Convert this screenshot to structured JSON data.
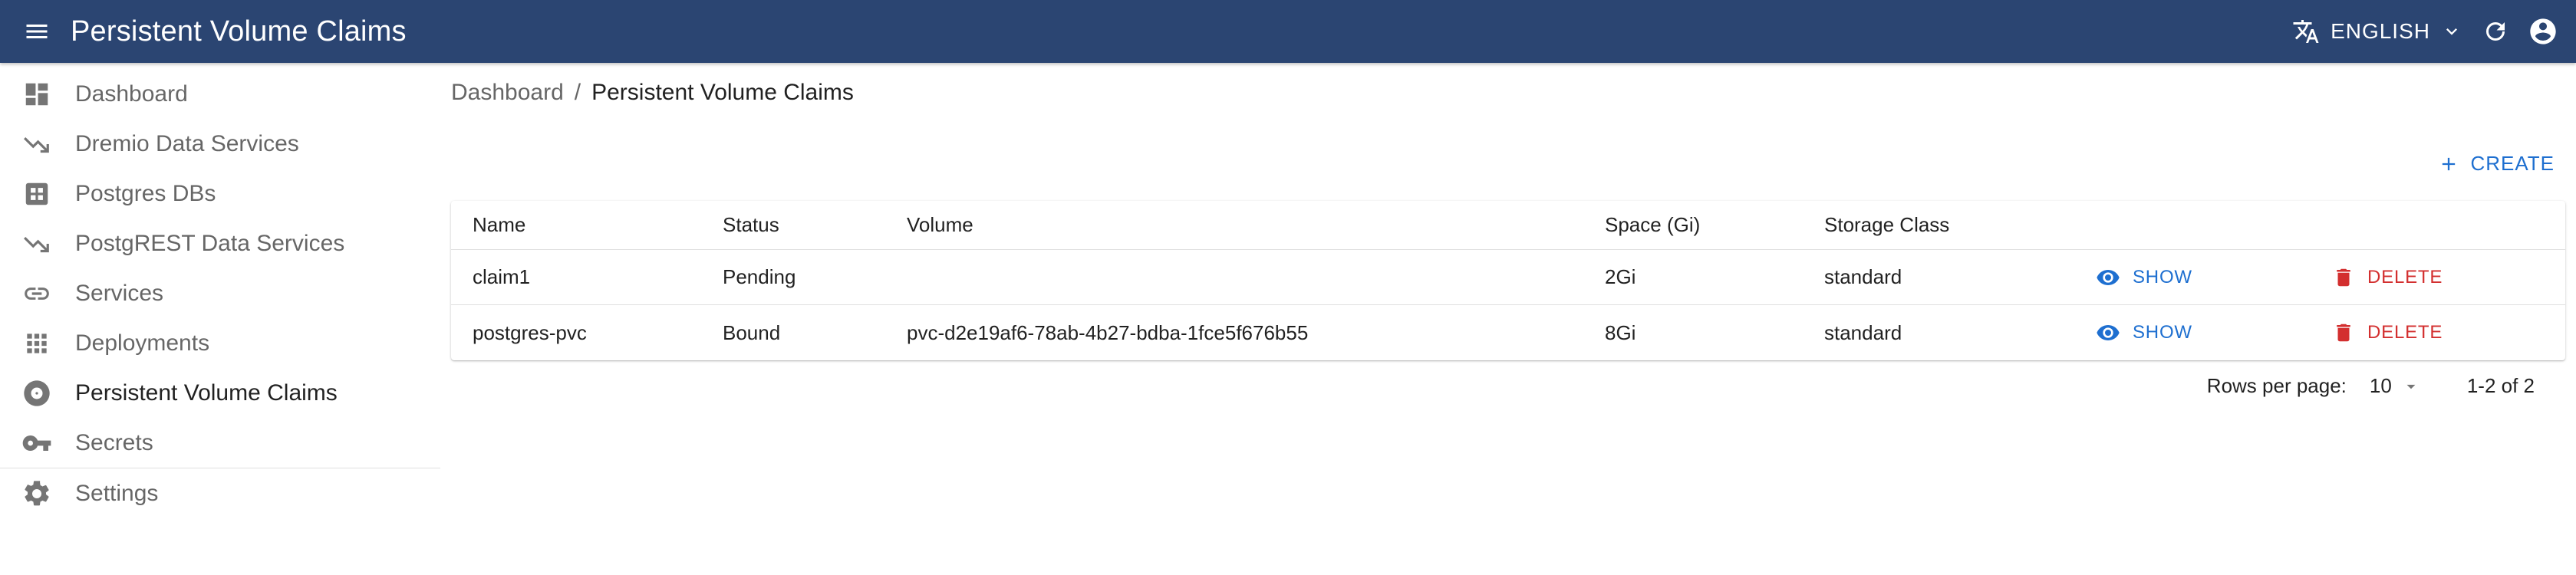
{
  "appbar": {
    "title": "Persistent Volume Claims",
    "language": "ENGLISH",
    "colors": {
      "background": "#2b4572",
      "text": "#ffffff"
    },
    "icons": [
      "menu-icon",
      "translate-icon",
      "chevron-down-icon",
      "refresh-icon",
      "account-circle-icon"
    ]
  },
  "sidebar": {
    "items": [
      {
        "label": "Dashboard",
        "icon": "dashboard-icon"
      },
      {
        "label": "Dremio Data Services",
        "icon": "trending-down-icon"
      },
      {
        "label": "Postgres DBs",
        "icon": "grid-box-icon"
      },
      {
        "label": "PostgREST Data Services",
        "icon": "trending-down-icon"
      },
      {
        "label": "Services",
        "icon": "link-icon"
      },
      {
        "label": "Deployments",
        "icon": "apps-icon"
      },
      {
        "label": "Persistent Volume Claims",
        "icon": "disc-icon",
        "active": true
      },
      {
        "label": "Secrets",
        "icon": "key-icon"
      },
      {
        "label": "Settings",
        "icon": "gear-icon"
      }
    ]
  },
  "breadcrumb": {
    "home": "Dashboard",
    "separator": "/",
    "current": "Persistent Volume Claims"
  },
  "toolbar": {
    "create_label": "CREATE",
    "accent": "#1e6fd0"
  },
  "table": {
    "columns": [
      "Name",
      "Status",
      "Volume",
      "Space (Gi)",
      "Storage Class"
    ],
    "rows": [
      {
        "name": "claim1",
        "status": "Pending",
        "volume": "",
        "space": "2Gi",
        "storage_class": "standard",
        "show": "SHOW",
        "delete": "DELETE"
      },
      {
        "name": "postgres-pvc",
        "status": "Bound",
        "volume": "pvc-d2e19af6-78ab-4b27-bdba-1fce5f676b55",
        "space": "8Gi",
        "storage_class": "standard",
        "show": "SHOW",
        "delete": "DELETE"
      }
    ],
    "colors": {
      "show": "#1e6fd0",
      "delete": "#d32f2f"
    }
  },
  "pagination": {
    "rows_per_page_label": "Rows per page:",
    "rows_per_page_value": "10",
    "range": "1-2 of 2"
  }
}
